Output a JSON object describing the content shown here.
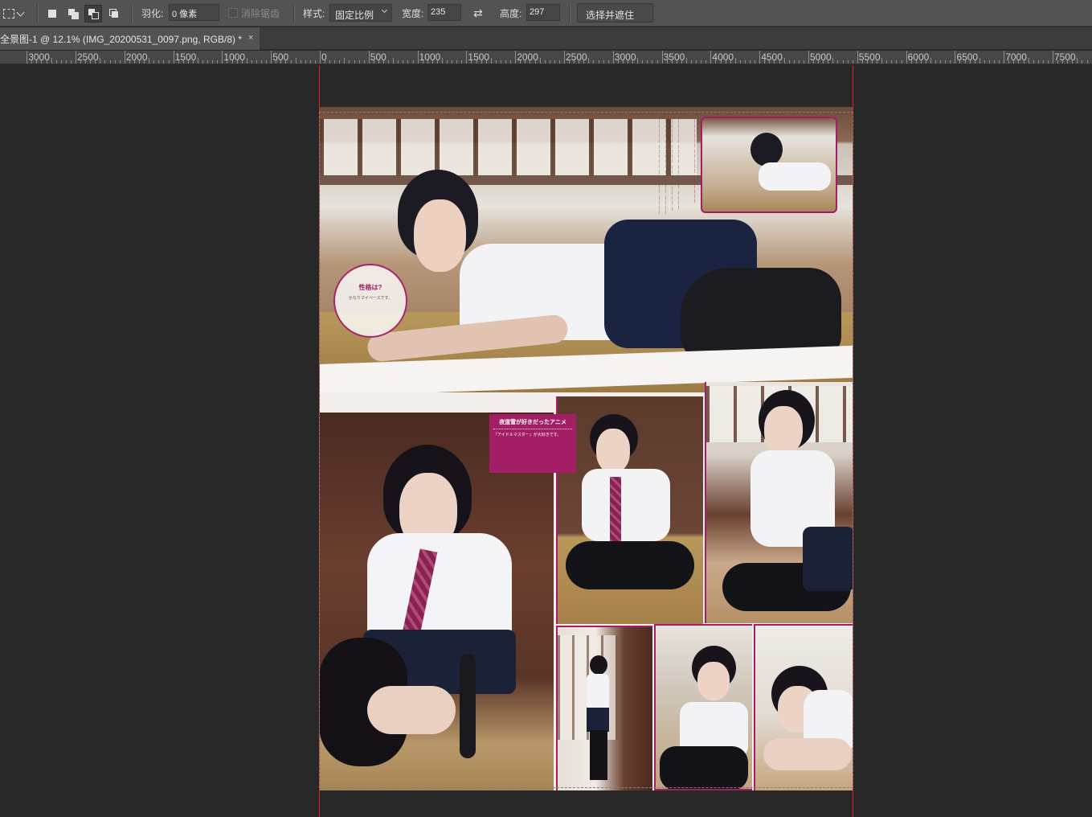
{
  "options_bar": {
    "feather_label": "羽化:",
    "feather_value": "0 像素",
    "antialias_label": "消除锯齿",
    "style_label": "样式:",
    "style_value": "固定比例",
    "width_label": "宽度:",
    "width_value": "235",
    "height_label": "高度:",
    "height_value": "297",
    "select_mask_label": "选择并遮住 ..."
  },
  "document_tab": {
    "title": "全景图-1 @ 12.1% (IMG_20200531_0097.png, RGB/8) *",
    "close": "×"
  },
  "ruler": {
    "labels": [
      "3000",
      "2500",
      "2000",
      "1500",
      "1000",
      "500",
      "0",
      "500",
      "1000",
      "1500",
      "2000",
      "2500",
      "3000",
      "3500",
      "4000",
      "4500",
      "5000",
      "5500",
      "6000",
      "6500",
      "7000",
      "7500"
    ]
  },
  "magazine": {
    "circle_heading": "性格は?",
    "circle_text": "かなりマイペースです。",
    "pink_box_title": "夜道雪が好きだったアニメ",
    "pink_box_text": "『アイドルマスター』が大好きです。"
  },
  "colors": {
    "guide": "#e02020",
    "accent_magenta": "#a41e66",
    "workspace": "#282828",
    "toolbar": "#535353"
  }
}
